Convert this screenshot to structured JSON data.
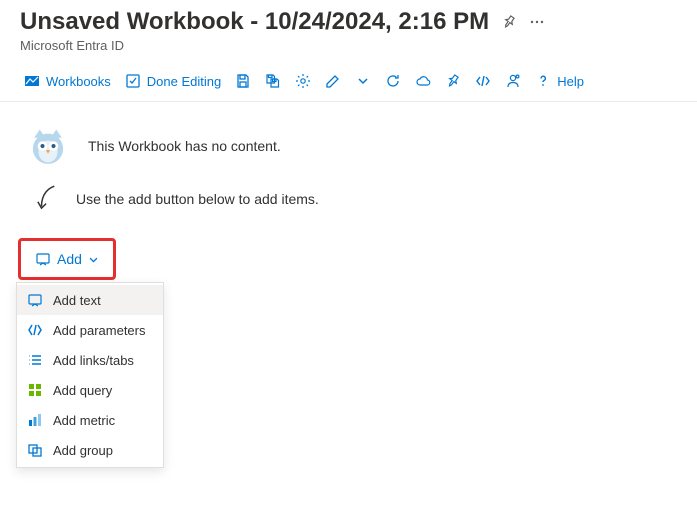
{
  "header": {
    "title": "Unsaved Workbook - 10/24/2024, 2:16 PM",
    "subtitle": "Microsoft Entra ID"
  },
  "toolbar": {
    "workbooks_label": "Workbooks",
    "done_editing_label": "Done Editing",
    "help_label": "Help"
  },
  "empty": {
    "no_content": "This Workbook has no content.",
    "hint": "Use the add button below to add items."
  },
  "add_button": {
    "label": "Add"
  },
  "menu": {
    "items": [
      {
        "label": "Add text"
      },
      {
        "label": "Add parameters"
      },
      {
        "label": "Add links/tabs"
      },
      {
        "label": "Add query"
      },
      {
        "label": "Add metric"
      },
      {
        "label": "Add group"
      }
    ]
  }
}
